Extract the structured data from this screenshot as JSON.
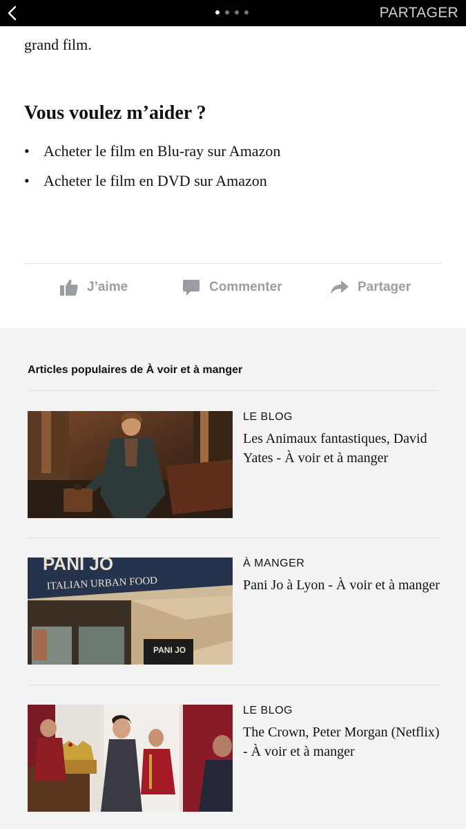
{
  "topbar": {
    "share_label": "PARTAGER",
    "page_dots": 4,
    "active_dot": 1
  },
  "article": {
    "continued_text": "grand film.",
    "help_title": "Vous voulez m’aider ?",
    "buy_links": [
      "Acheter le film en Blu-ray sur Amazon",
      "Acheter le film en DVD sur Amazon"
    ],
    "bullet": "•"
  },
  "actions": {
    "like_label": "J’aime",
    "comment_label": "Commenter",
    "share_label": "Partager",
    "color": "#9a9da3"
  },
  "popular": {
    "title": "Articles populaires de À voir et à manger",
    "cards": [
      {
        "category": "LE BLOG",
        "title": "Les Animaux fantastiques, David Yates - À voir et à manger"
      },
      {
        "category": "À MANGER",
        "title": "Pani Jo à Lyon - À voir et à manger"
      },
      {
        "category": "LE BLOG",
        "title": "The Crown, Peter Morgan (Netflix) - À voir et à manger"
      }
    ],
    "image_texts": [
      "PANI JO",
      "ITALIAN URBAN FOOD",
      "PANI JO"
    ]
  }
}
